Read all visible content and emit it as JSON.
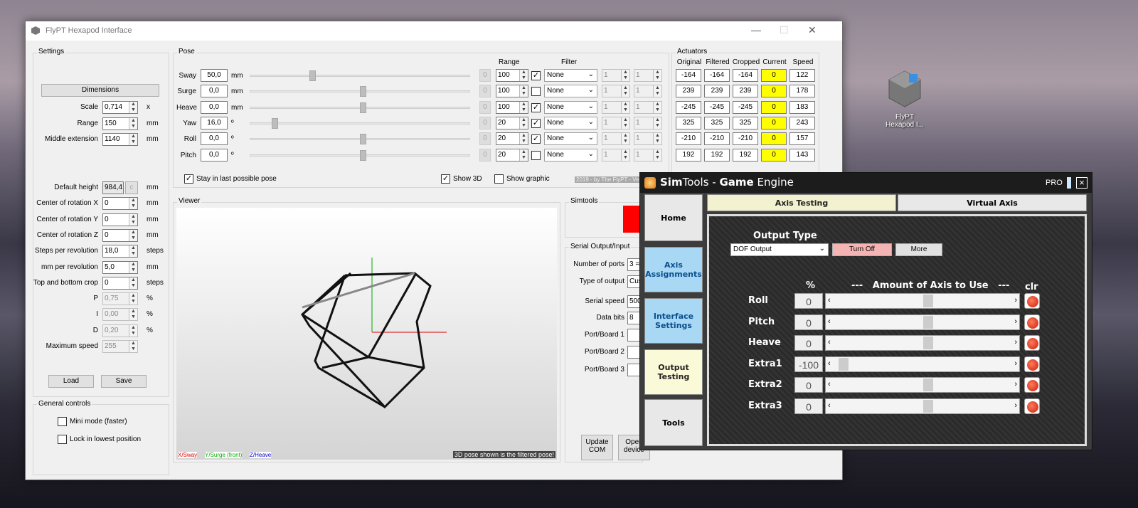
{
  "window": {
    "title": "FlyPT Hexapod Interface"
  },
  "settings": {
    "group": "Settings",
    "dimensions": "Dimensions",
    "rows": [
      {
        "label": "Scale",
        "value": "0,714",
        "unit": "x"
      },
      {
        "label": "Range",
        "value": "150",
        "unit": "mm"
      },
      {
        "label": "Middle extension",
        "value": "1140",
        "unit": "mm"
      }
    ],
    "rows2": [
      {
        "label": "Default height",
        "value": "984,4",
        "unit": "mm"
      },
      {
        "label": "Center of rotation X",
        "value": "0",
        "unit": "mm"
      },
      {
        "label": "Center of rotation Y",
        "value": "0",
        "unit": "mm"
      },
      {
        "label": "Center of rotation Z",
        "value": "0",
        "unit": "mm"
      },
      {
        "label": "Steps per revolution",
        "value": "18,0",
        "unit": "steps"
      },
      {
        "label": "mm per revolution",
        "value": "5,0",
        "unit": "mm"
      },
      {
        "label": "Top and bottom crop",
        "value": "0",
        "unit": "steps"
      },
      {
        "label": "P",
        "value": "0,75",
        "unit": "%"
      },
      {
        "label": "I",
        "value": "0,00",
        "unit": "%"
      },
      {
        "label": "D",
        "value": "0,20",
        "unit": "%"
      },
      {
        "label": "Maximum speed",
        "value": "255",
        "unit": ""
      }
    ],
    "default_height_btn": "c",
    "load": "Load",
    "save": "Save"
  },
  "general": {
    "group": "General controls",
    "mini": "Mini mode (faster)",
    "lock": "Lock in lowest position"
  },
  "pose": {
    "group": "Pose",
    "range_header": "Range",
    "filter_header": "Filter",
    "rows": [
      {
        "label": "Sway",
        "value": "50,0",
        "unit": "mm",
        "slider": 0.27,
        "range": "100",
        "checked": true,
        "filter": "None",
        "f1": "1",
        "f2": "1"
      },
      {
        "label": "Surge",
        "value": "0,0",
        "unit": "mm",
        "slider": 0.5,
        "range": "100",
        "checked": false,
        "filter": "None",
        "f1": "1",
        "f2": "1"
      },
      {
        "label": "Heave",
        "value": "0,0",
        "unit": "mm",
        "slider": 0.5,
        "range": "100",
        "checked": true,
        "filter": "None",
        "f1": "1",
        "f2": "1"
      },
      {
        "label": "Yaw",
        "value": "16,0",
        "unit": "º",
        "slider": 0.1,
        "range": "20",
        "checked": true,
        "filter": "None",
        "f1": "1",
        "f2": "1"
      },
      {
        "label": "Roll",
        "value": "0,0",
        "unit": "º",
        "slider": 0.5,
        "range": "20",
        "checked": true,
        "filter": "None",
        "f1": "1",
        "f2": "1"
      },
      {
        "label": "Pitch",
        "value": "0,0",
        "unit": "º",
        "slider": 0.5,
        "range": "20",
        "checked": false,
        "filter": "None",
        "f1": "1",
        "f2": "1"
      }
    ],
    "zero": "0",
    "stay": "Stay in last possible pose",
    "show3d": "Show 3D",
    "showgraphic": "Show graphic",
    "credit": "2019 - by The FlyPT - Ve"
  },
  "actuators": {
    "group": "Actuators",
    "headers": [
      "Original",
      "Filtered",
      "Cropped",
      "Current",
      "Speed"
    ],
    "rows": [
      [
        "-164",
        "-164",
        "-164",
        "0",
        "122"
      ],
      [
        "239",
        "239",
        "239",
        "0",
        "178"
      ],
      [
        "-245",
        "-245",
        "-245",
        "0",
        "183"
      ],
      [
        "325",
        "325",
        "325",
        "0",
        "243"
      ],
      [
        "-210",
        "-210",
        "-210",
        "0",
        "157"
      ],
      [
        "192",
        "192",
        "192",
        "0",
        "143"
      ]
    ]
  },
  "viewer": {
    "group": "Viewer",
    "x": "X/Sway",
    "y": "Y/Surge (front)",
    "z": "Z/Heave",
    "note": "3D pose shown is the filtered pose!"
  },
  "simtools_group": {
    "group": "Simtools"
  },
  "serial": {
    "group": "Serial Output/Input",
    "rows": [
      {
        "label": "Number of ports",
        "value": "3 ="
      },
      {
        "label": "Type of output",
        "value": "Cus"
      },
      {
        "label": "Serial speed",
        "value": "500"
      },
      {
        "label": "Data bits",
        "value": "8"
      },
      {
        "label": "Port/Board 1",
        "value": ""
      },
      {
        "label": "Port/Board 2",
        "value": ""
      },
      {
        "label": "Port/Board 3",
        "value": ""
      }
    ],
    "update": "Update COM",
    "open": "Open device"
  },
  "desktop": {
    "icon_label": "FlyPT Hexapod I..."
  },
  "simtools": {
    "title_a": "Sim",
    "title_b": "Tools",
    "title_c": " - ",
    "title_d": "Game",
    "title_e": " Engine",
    "pro": "PRO",
    "close": "×",
    "nav": [
      "Home",
      "Axis Assignments",
      "Interface Settings",
      "Output Testing",
      "Tools"
    ],
    "tabs": [
      "Axis Testing",
      "Virtual Axis"
    ],
    "output_type": "Output Type",
    "dof": "DOF Output",
    "turnoff": "Turn Off",
    "more": "More",
    "pct": "%",
    "amount": "---   Amount of Axis to Use   ---",
    "clr": "clr",
    "axes": [
      {
        "label": "Roll",
        "value": "0",
        "level": 0.5
      },
      {
        "label": "Pitch",
        "value": "0",
        "level": 0.5
      },
      {
        "label": "Heave",
        "value": "0",
        "level": 0.5
      },
      {
        "label": "Extra1",
        "value": "-100",
        "level": 0.0
      },
      {
        "label": "Extra2",
        "value": "0",
        "level": 0.5
      },
      {
        "label": "Extra3",
        "value": "0",
        "level": 0.5
      }
    ]
  },
  "colors": {
    "accent_yellow": "#ffff00",
    "st_blue": "#a8d8f4",
    "turnoff": "#f4b4b4"
  }
}
